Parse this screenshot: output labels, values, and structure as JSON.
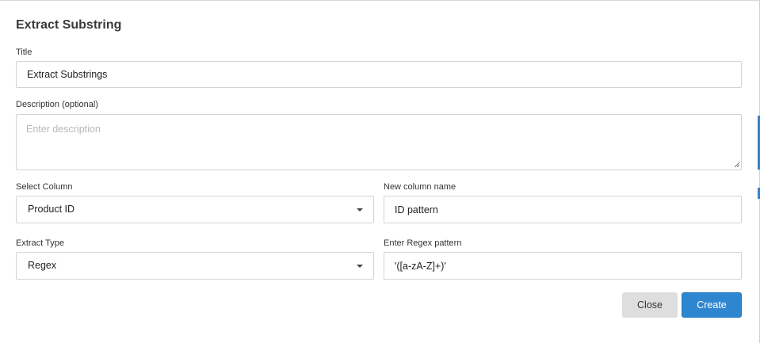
{
  "dialog": {
    "title": "Extract Substring"
  },
  "fields": {
    "title": {
      "label": "Title",
      "value": "Extract Substrings"
    },
    "description": {
      "label": "Description (optional)",
      "placeholder": "Enter description",
      "value": ""
    },
    "select_column": {
      "label": "Select Column",
      "value": "Product ID"
    },
    "new_column_name": {
      "label": "New column name",
      "value": "ID pattern"
    },
    "extract_type": {
      "label": "Extract Type",
      "value": "Regex"
    },
    "regex_pattern": {
      "label": "Enter Regex pattern",
      "value": "'([a-zA-Z]+)'"
    }
  },
  "buttons": {
    "close": "Close",
    "create": "Create"
  },
  "colors": {
    "primary": "#2f86d0",
    "secondary_button": "#dedede",
    "border": "#d4d4d4"
  },
  "icons": {
    "select_caret": "chevron-down-icon",
    "textarea_resize": "resize-grip-icon"
  }
}
